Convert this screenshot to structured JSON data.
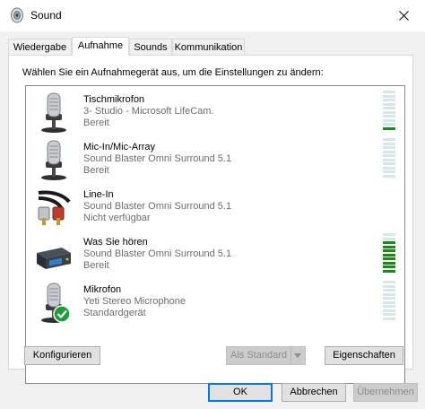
{
  "window": {
    "title": "Sound",
    "title_icon": "speaker-icon",
    "close_icon": "close-icon"
  },
  "tabs": [
    {
      "label": "Wiedergabe"
    },
    {
      "label": "Aufnahme"
    },
    {
      "label": "Sounds"
    },
    {
      "label": "Kommunikation"
    }
  ],
  "active_tab": "Aufnahme",
  "instruction": "Wählen Sie ein Aufnahmegerät aus, um die Einstellungen zu ändern:",
  "devices": [
    {
      "name": "Tischmikrofon",
      "description": "3- Studio - Microsoft LifeCam.",
      "state": "Bereit",
      "icon": "microphone-icon",
      "level": 0.1,
      "is_default": false
    },
    {
      "name": "Mic-In/Mic-Array",
      "description": "Sound Blaster Omni Surround 5.1",
      "state": "Bereit",
      "icon": "microphone-icon",
      "level": 0,
      "is_default": false
    },
    {
      "name": "Line-In",
      "description": "Sound Blaster Omni Surround 5.1",
      "state": "Nicht verfügbar",
      "icon": "rca-cable-icon",
      "level": null,
      "is_default": false
    },
    {
      "name": "Was Sie hören",
      "description": "Sound Blaster Omni Surround 5.1",
      "state": "Bereit",
      "icon": "sound-card-icon",
      "level": 0.8,
      "is_default": false
    },
    {
      "name": "Mikrofon",
      "description": "Yeti Stereo Microphone",
      "state": "Standardgerät",
      "icon": "microphone-icon",
      "level": 0,
      "is_default": true
    }
  ],
  "buttons": {
    "configure": "Konfigurieren",
    "set_default": "Als Standard",
    "properties": "Eigenschaften",
    "ok": "OK",
    "cancel": "Abbrechen",
    "apply": "Übernehmen"
  },
  "colors": {
    "level_on": "#1b8a1b",
    "level_off": "#d6e6ea",
    "default_check": "#1e9e3a",
    "focus_border": "#0078d7"
  }
}
